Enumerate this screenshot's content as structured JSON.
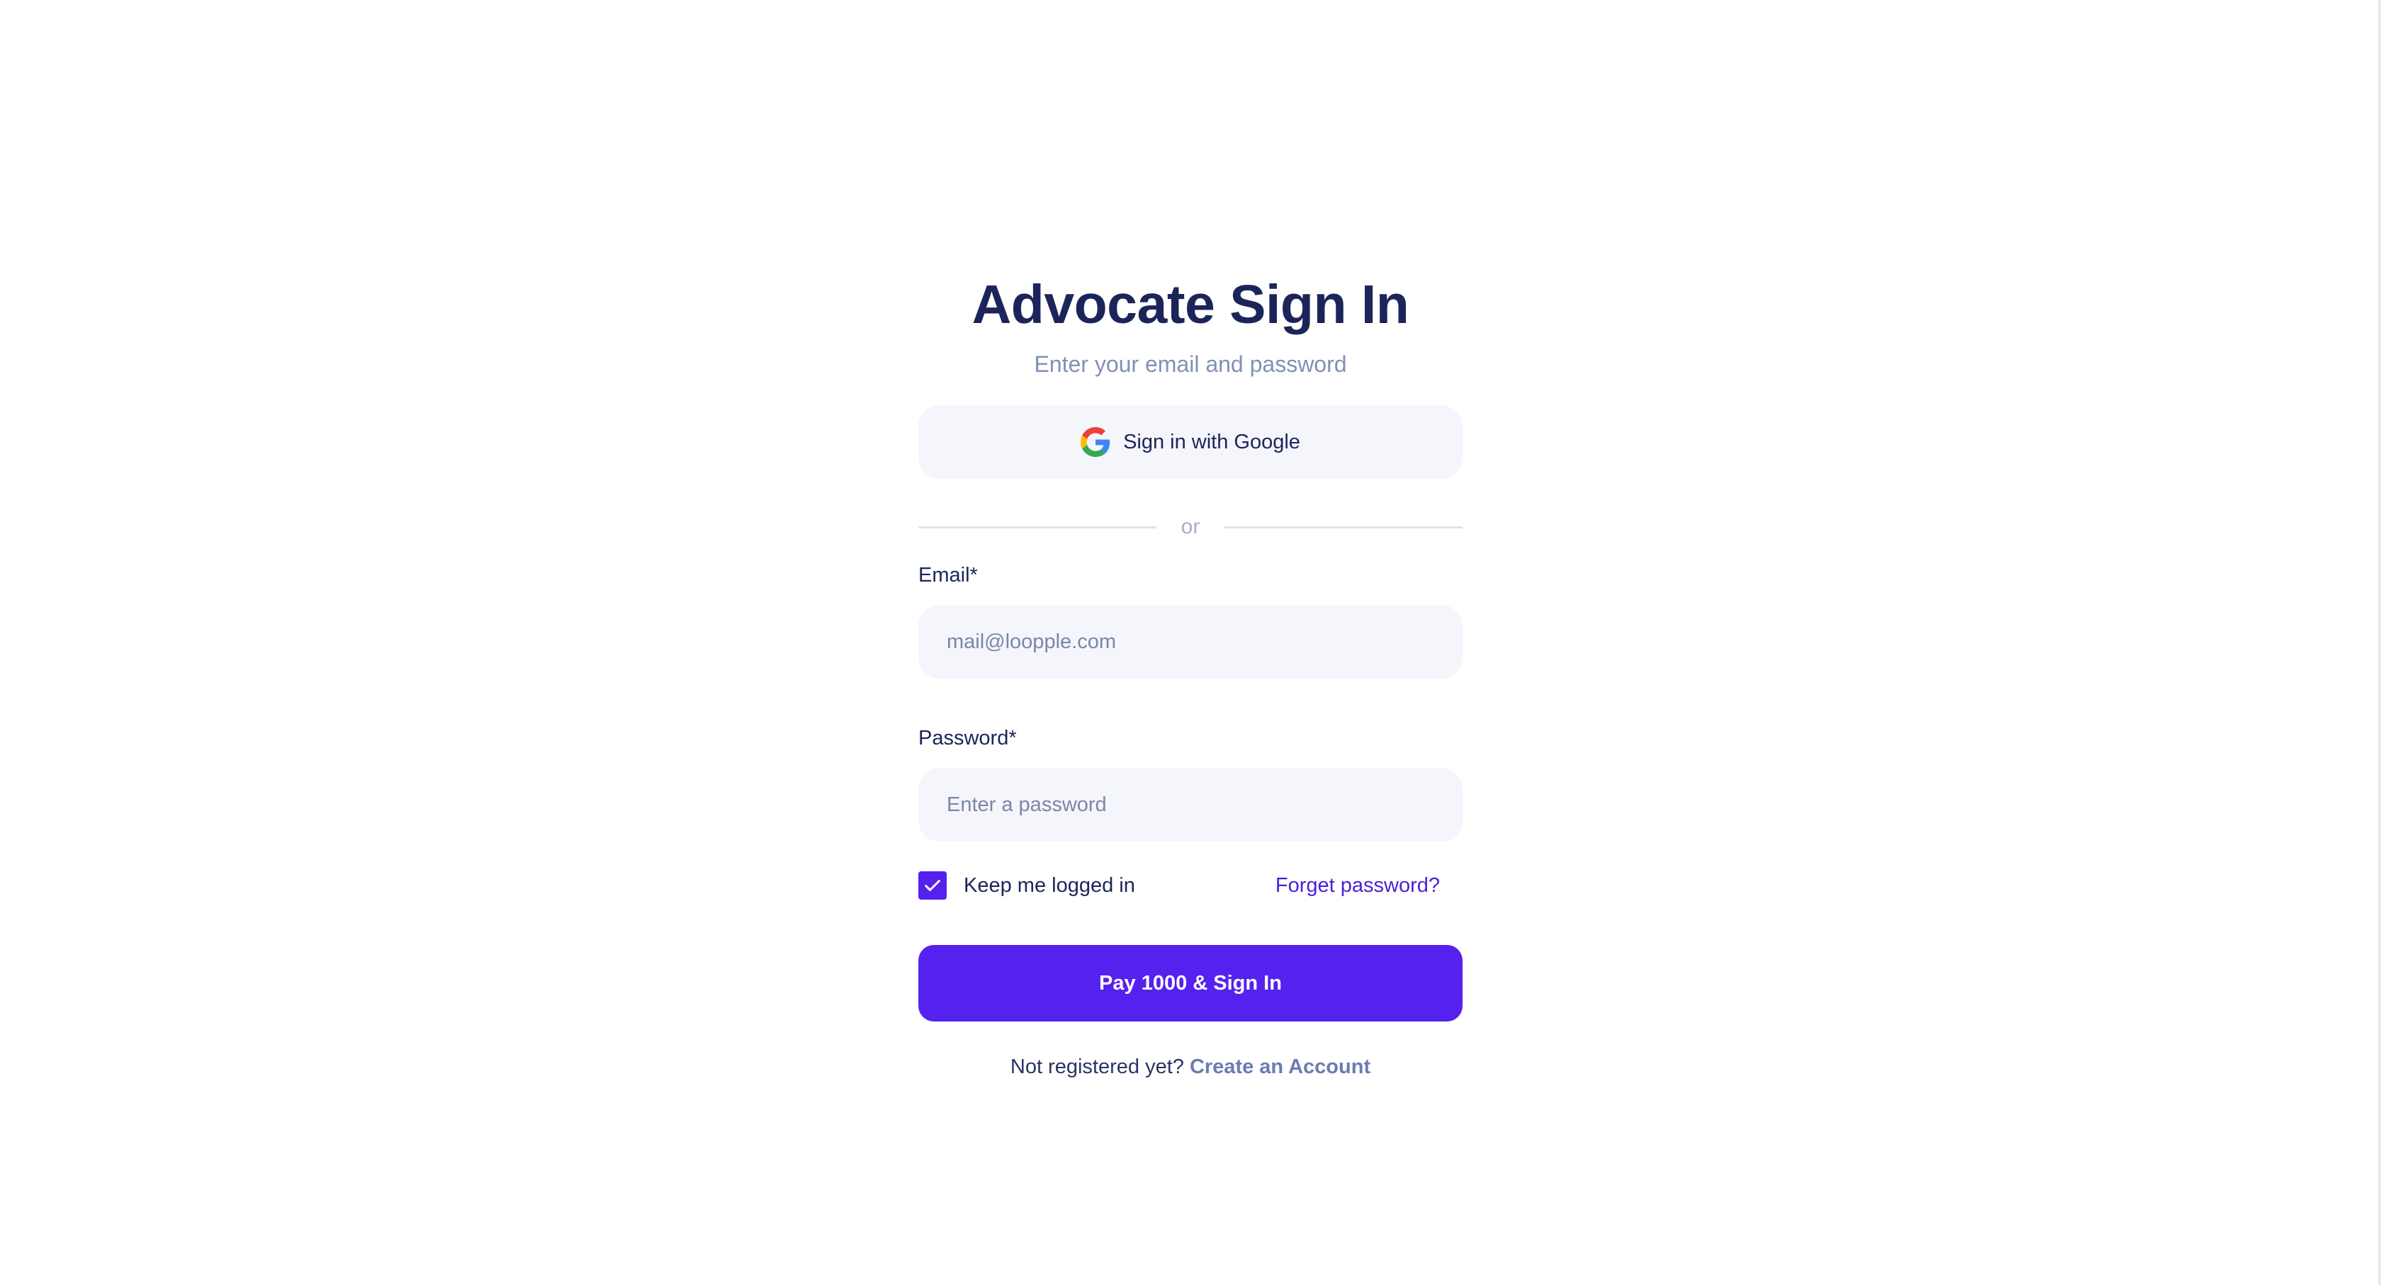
{
  "header": {
    "title": "Advocate Sign In",
    "subtitle": "Enter your email and password"
  },
  "google": {
    "label": "Sign in with Google",
    "icon": "google-icon"
  },
  "divider": {
    "text": "or"
  },
  "email": {
    "label": "Email*",
    "placeholder": "mail@loopple.com",
    "value": ""
  },
  "password": {
    "label": "Password*",
    "placeholder": "Enter a password",
    "value": ""
  },
  "keep_logged_in": {
    "label": "Keep me logged in",
    "checked": true
  },
  "forget": {
    "label": "Forget password?"
  },
  "submit": {
    "label": "Pay 1000 & Sign In"
  },
  "register": {
    "text": "Not registered yet? ",
    "link": "Create an Account"
  },
  "colors": {
    "brand": "#5521ef",
    "title": "#1b2559",
    "muted": "#8190b5",
    "field_bg": "#f4f6fb"
  }
}
